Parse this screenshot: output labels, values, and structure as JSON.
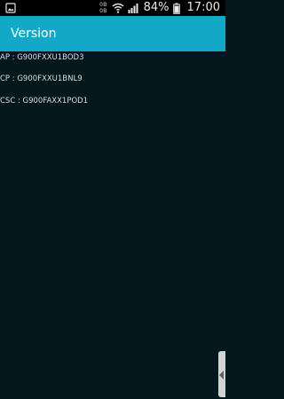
{
  "status_bar": {
    "left_icon": "image-icon",
    "network_top": "0B",
    "network_bottom": "0B",
    "wifi_icon": "wifi-icon",
    "signal_icon": "signal-icon",
    "battery": "84%",
    "time": "17:00"
  },
  "app_bar": {
    "title": "Version",
    "color": "#13a8c8"
  },
  "versions": {
    "ap": "AP : G900FXXU1BOD3",
    "cp": "CP : G900FXXU1BNL9",
    "csc": "CSC : G900FAXX1POD1"
  },
  "side_handle": {
    "icon": "chevron-left-icon"
  },
  "colors": {
    "background": "#04171b",
    "status_bar": "#000000",
    "text": "#d9dde0"
  }
}
